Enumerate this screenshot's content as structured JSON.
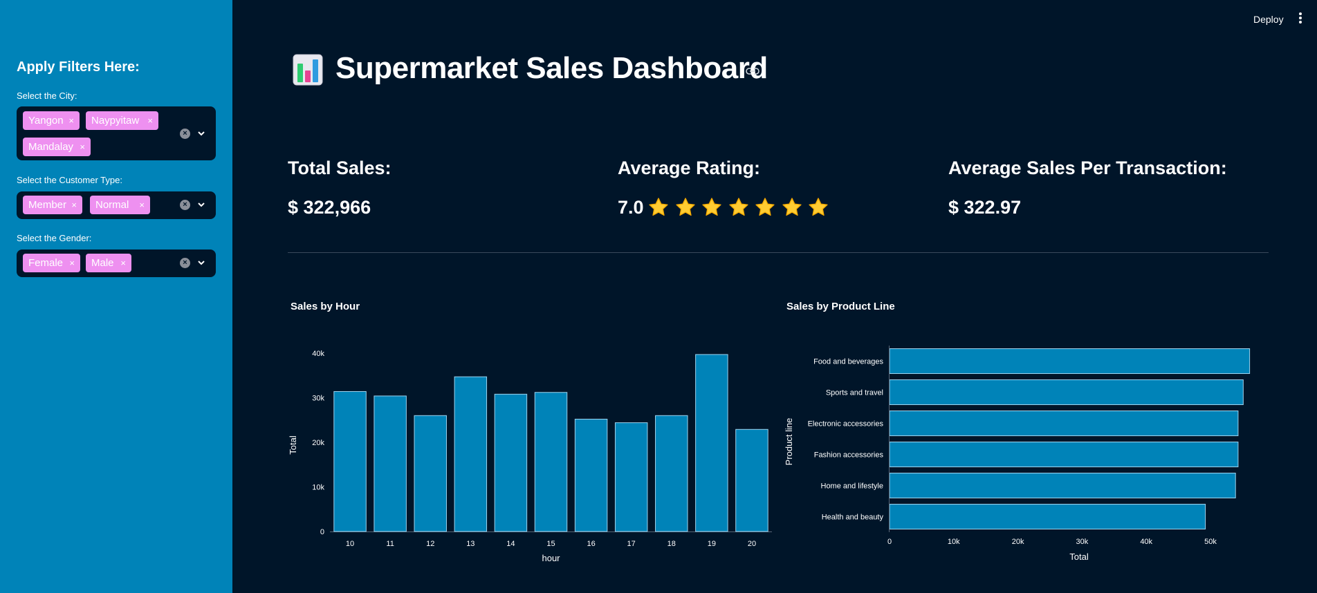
{
  "sidebar": {
    "heading": "Apply Filters Here:",
    "filters": [
      {
        "label": "Select the City:",
        "selected": [
          "Yangon",
          "Naypyitaw",
          "Mandalay"
        ]
      },
      {
        "label": "Select the Customer Type:",
        "selected": [
          "Member",
          "Normal"
        ]
      },
      {
        "label": "Select the Gender:",
        "selected": [
          "Female",
          "Male"
        ]
      }
    ],
    "tag_remove_glyph": "×",
    "accent_color": "#0083B8",
    "tag_color": "#EE90F0"
  },
  "header": {
    "deploy_label": "Deploy",
    "title": "Supermarket Sales Dashboard",
    "title_icon": "bar-chart-emoji-icon"
  },
  "kpis": {
    "total_sales": {
      "label": "Total Sales:",
      "value": "$ 322,966"
    },
    "average_rating": {
      "label": "Average Rating:",
      "value": "7.0",
      "stars": 7
    },
    "avg_per_txn": {
      "label": "Average Sales Per Transaction:",
      "value": "$ 322.97"
    }
  },
  "chart_data": [
    {
      "type": "bar",
      "title": "Sales by Hour",
      "xlabel": "hour",
      "ylabel": "Total",
      "categories": [
        "10",
        "11",
        "12",
        "13",
        "14",
        "15",
        "16",
        "17",
        "18",
        "19",
        "20"
      ],
      "values": [
        31400,
        30400,
        26000,
        34700,
        30800,
        31200,
        25200,
        24400,
        26000,
        39700,
        22900
      ],
      "ylim": [
        0,
        40000
      ],
      "yticks": [
        "0",
        "10k",
        "20k",
        "30k",
        "40k"
      ],
      "bar_color": "#0083B8",
      "grid": false
    },
    {
      "type": "bar",
      "orientation": "horizontal",
      "title": "Sales by Product Line",
      "xlabel": "Total",
      "ylabel": "Product line",
      "categories": [
        "Food and beverages",
        "Sports and travel",
        "Electronic accessories",
        "Fashion accessories",
        "Home and lifestyle",
        "Health and beauty"
      ],
      "values": [
        56100,
        55100,
        54300,
        54300,
        53900,
        49200
      ],
      "xlim": [
        0,
        50000
      ],
      "xticks": [
        "0",
        "10k",
        "20k",
        "30k",
        "40k",
        "50k"
      ],
      "bar_color": "#0083B8",
      "grid": false
    }
  ]
}
